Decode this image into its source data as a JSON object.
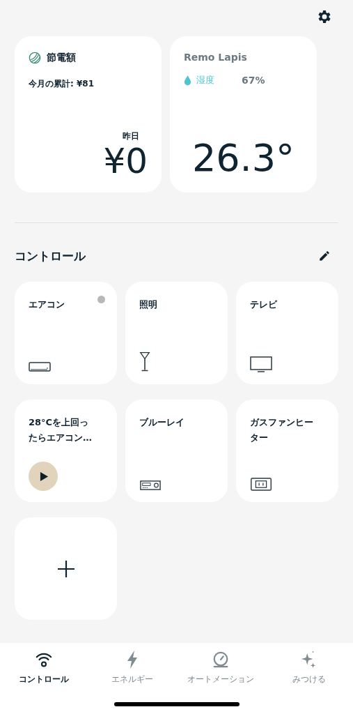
{
  "savings_card": {
    "title": "節電額",
    "monthly_total": "今月の累計: ¥81",
    "yesterday_label": "昨日",
    "yesterday_amount": "¥0"
  },
  "sensor_card": {
    "title": "Remo Lapis",
    "humidity_label": "湿度",
    "humidity_value": "67%",
    "temperature": "26.3°"
  },
  "controls": {
    "title": "コントロール",
    "tiles": [
      {
        "kind": "aircon",
        "label": "エアコン",
        "status_dot": true
      },
      {
        "kind": "light",
        "label": "照明",
        "status_dot": false
      },
      {
        "kind": "tv",
        "label": "テレビ",
        "status_dot": false
      },
      {
        "kind": "scene",
        "label": "28°Cを上回ったらエアコン…",
        "status_dot": false
      },
      {
        "kind": "bluray",
        "label": "ブルーレイ",
        "status_dot": false
      },
      {
        "kind": "outlet",
        "label": "ガスファンヒーター",
        "status_dot": false
      },
      {
        "kind": "add"
      }
    ]
  },
  "tab_bar": [
    {
      "kind": "control",
      "label": "コントロール",
      "selected": true
    },
    {
      "kind": "energy",
      "label": "エネルギー",
      "selected": false
    },
    {
      "kind": "automation",
      "label": "オートメーション",
      "selected": false
    },
    {
      "kind": "discover",
      "label": "みつける",
      "selected": false
    }
  ]
}
